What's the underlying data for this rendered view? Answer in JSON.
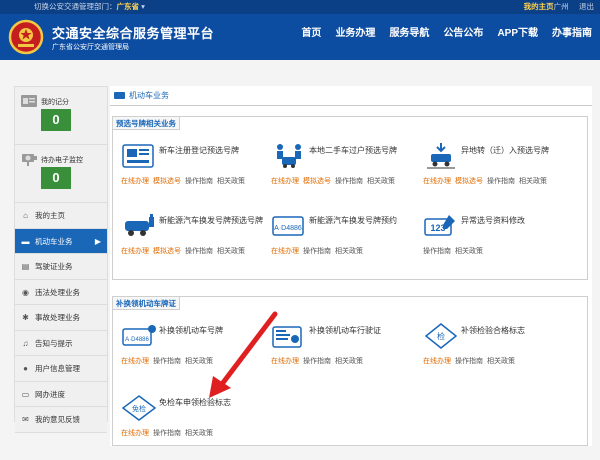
{
  "topbar": {
    "switch_label": "切换公安交通管理部门：",
    "province": "广东省",
    "my_home": "我的主页",
    "my_home_suffix": "广州",
    "logout": "退出"
  },
  "header": {
    "title": "交通安全综合服务管理平台",
    "subtitle": "广东省公安厅交通管理局",
    "nav": [
      "首页",
      "业务办理",
      "服务导航",
      "公告公布",
      "APP下载",
      "办事指南"
    ]
  },
  "sidebar": {
    "score_label": "我的记分",
    "score_value": "0",
    "violation_label": "待办电子监控",
    "violation_value": "0",
    "items": [
      {
        "label": "我的主页",
        "icon": "home-icon",
        "glyph": "⌂"
      },
      {
        "label": "机动车业务",
        "icon": "car-icon",
        "glyph": "▬",
        "active": true,
        "arrow": "▶"
      },
      {
        "label": "驾驶证业务",
        "icon": "license-icon",
        "glyph": "▤"
      },
      {
        "label": "违法处理业务",
        "icon": "camera-icon",
        "glyph": "◉"
      },
      {
        "label": "事故处理业务",
        "icon": "accident-icon",
        "glyph": "✱"
      },
      {
        "label": "告知与提示",
        "icon": "bell-icon",
        "glyph": "♫"
      },
      {
        "label": "用户信息管理",
        "icon": "user-icon",
        "glyph": "●"
      },
      {
        "label": "网办进度",
        "icon": "monitor-icon",
        "glyph": "▭"
      },
      {
        "label": "我的意见反馈",
        "icon": "feedback-icon",
        "glyph": "✉"
      }
    ]
  },
  "main": {
    "breadcrumb": "机动车业务",
    "sections": [
      {
        "title": "预选号牌相关业务",
        "services": [
          {
            "name": "新车注册登记预选号牌",
            "links": [
              "在线办理",
              "模拟选号",
              "操作指南",
              "相关政策"
            ],
            "icon": "new-car-plate-icon"
          },
          {
            "name": "本地二手车过户预选号牌",
            "links": [
              "在线办理",
              "模拟选号",
              "操作指南",
              "相关政策"
            ],
            "icon": "used-car-transfer-icon"
          },
          {
            "name": "异地转（迁）入预选号牌",
            "links": [
              "在线办理",
              "模拟选号",
              "操作指南",
              "相关政策"
            ],
            "icon": "transfer-in-icon"
          },
          {
            "name": "新能源汽车换发号牌预选号牌",
            "links": [
              "在线办理",
              "模拟选号",
              "操作指南",
              "相关政策"
            ],
            "icon": "new-energy-car-icon"
          },
          {
            "name": "新能源汽车换发号牌预约",
            "links": [
              "在线办理",
              "操作指南",
              "相关政策"
            ],
            "icon": "new-energy-plate-icon"
          },
          {
            "name": "异常选号资料修改",
            "links": [
              "操作指南",
              "相关政策"
            ],
            "icon": "number-edit-icon"
          }
        ]
      },
      {
        "title": "补换领机动车牌证",
        "services": [
          {
            "name": "补换领机动车号牌",
            "links": [
              "在线办理",
              "操作指南",
              "相关政策"
            ],
            "icon": "plate-replace-icon"
          },
          {
            "name": "补换领机动车行驶证",
            "links": [
              "在线办理",
              "操作指南",
              "相关政策"
            ],
            "icon": "license-replace-icon"
          },
          {
            "name": "补领检验合格标志",
            "links": [
              "在线办理",
              "操作指南",
              "相关政策"
            ],
            "icon": "inspection-label-icon"
          },
          {
            "name": "免检车申领检验标志",
            "links": [
              "在线办理",
              "操作指南",
              "相关政策"
            ],
            "icon": "exempt-label-icon"
          }
        ]
      }
    ]
  },
  "plate_text": "A·D4886",
  "inspect_text": "检",
  "exempt_text": "免检",
  "number_text": "123",
  "colors": {
    "header": "#0d4da1",
    "topbar": "#0b3f86",
    "accent": "#1a67b8",
    "online": "#e06b00",
    "score": "#3a8f3a",
    "arrow": "#e02020"
  }
}
